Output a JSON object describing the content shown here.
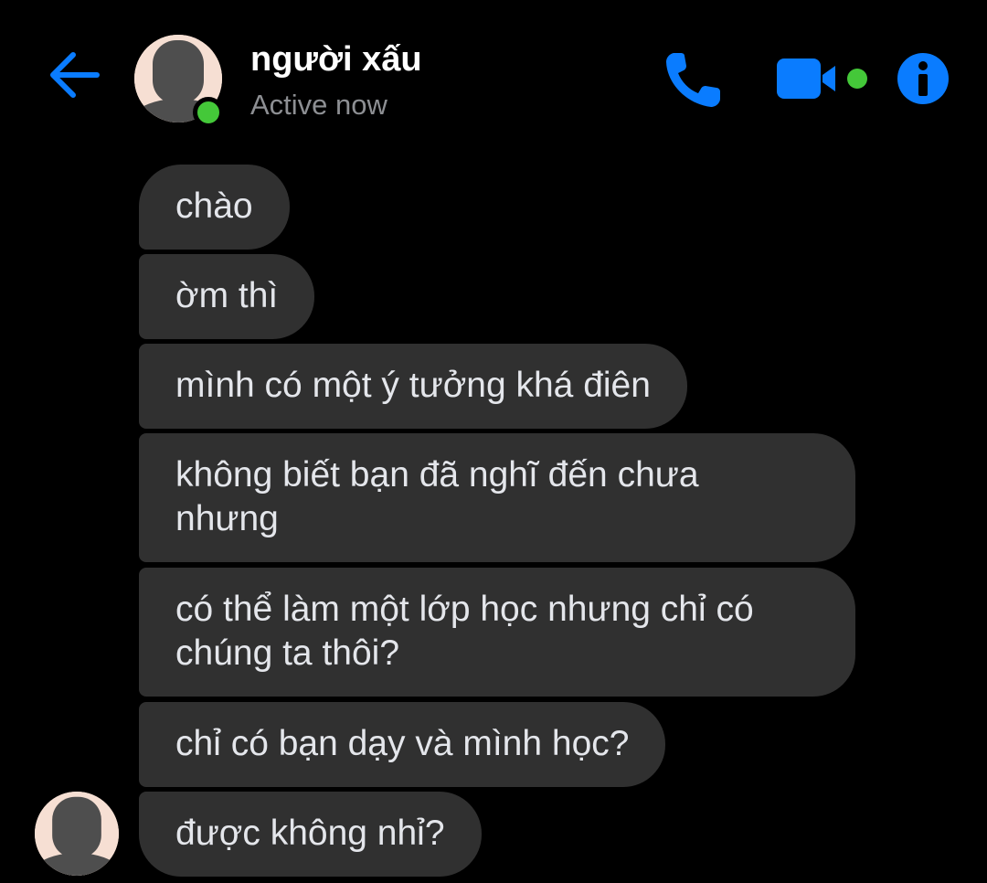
{
  "header": {
    "back_icon": "arrow-left-icon",
    "contact_name": "người xấu",
    "status": "Active now",
    "actions": [
      {
        "name": "voice-call",
        "icon": "phone-icon"
      },
      {
        "name": "video-call",
        "icon": "video-camera-icon"
      },
      {
        "name": "conversation-info",
        "icon": "info-icon"
      }
    ]
  },
  "messages": [
    {
      "text": "chào"
    },
    {
      "text": "ờm thì"
    },
    {
      "text": "mình có một ý tưởng khá điên"
    },
    {
      "text": "không biết bạn đã nghĩ đến chưa nhưng"
    },
    {
      "text": "có thể làm một lớp học nhưng chỉ có chúng ta thôi?"
    },
    {
      "text": "chỉ có bạn dạy và mình học?"
    },
    {
      "text": "được không nhỉ?"
    }
  ],
  "colors": {
    "background": "#000000",
    "accent": "#0a7cff",
    "bubble": "#303030",
    "bubble_text": "#e4e6eb",
    "status_text": "#8d8f93",
    "online": "#44c839"
  }
}
